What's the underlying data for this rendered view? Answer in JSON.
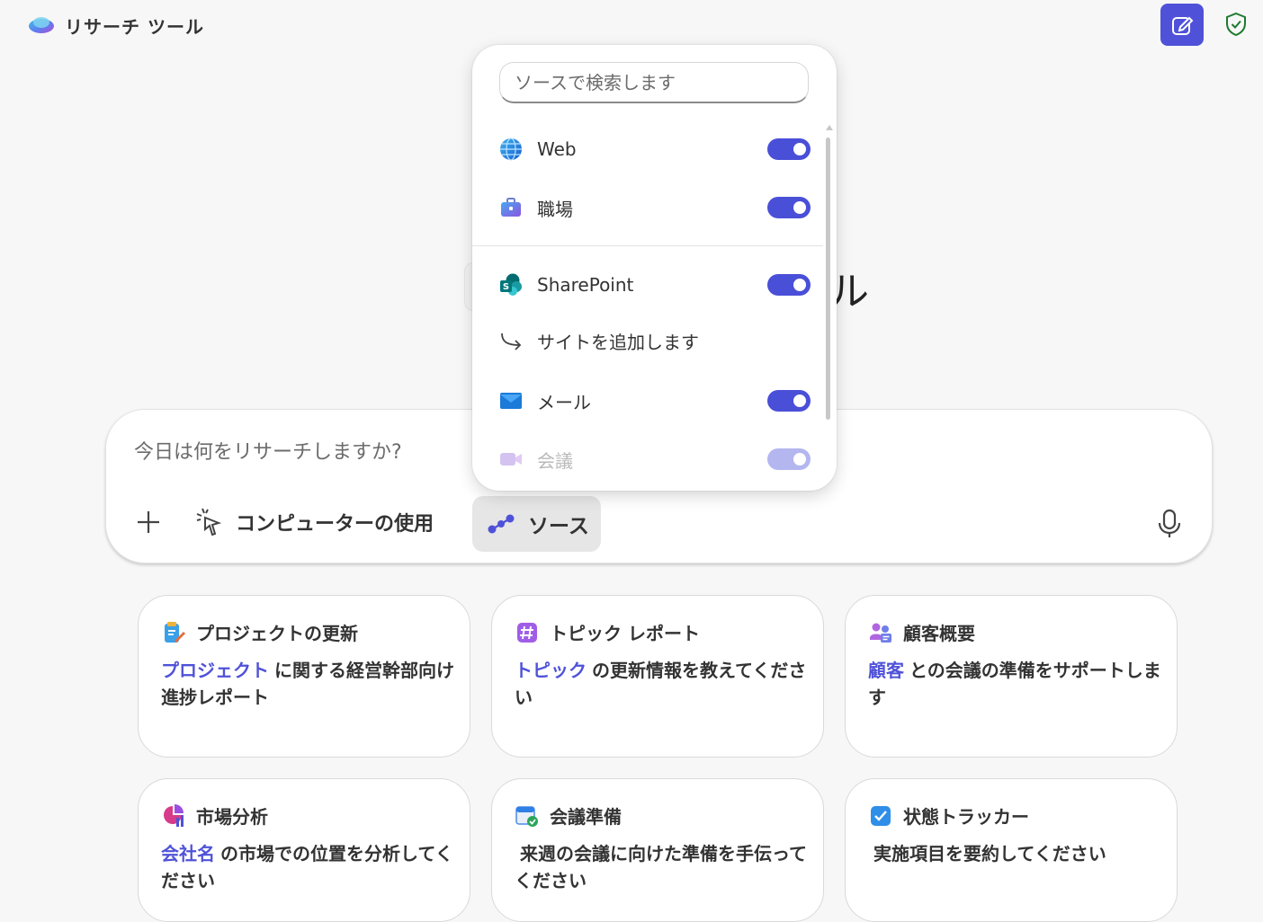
{
  "header": {
    "app_title": "リサーチ ツール",
    "compose_icon": "compose-icon",
    "shield_icon": "shield-check-icon"
  },
  "background_heading_glyph": "ル",
  "composer": {
    "placeholder": "今日は何をリサーチしますか?",
    "tools": {
      "add_icon": "plus-icon",
      "computer_use_label": "コンピューターの使用",
      "sources_label": "ソース"
    },
    "mic_icon": "microphone-icon"
  },
  "sources_popup": {
    "search_placeholder": "ソースで検索します",
    "items": [
      {
        "label": "Web",
        "icon": "globe-icon",
        "enabled": true
      },
      {
        "label": "職場",
        "icon": "briefcase-icon",
        "enabled": true
      },
      {
        "label": "SharePoint",
        "icon": "sharepoint-icon",
        "enabled": true
      },
      {
        "label": "サイトを追加します",
        "icon": "arrow-return-icon"
      },
      {
        "label": "メール",
        "icon": "mail-icon",
        "enabled": true
      },
      {
        "label": "会議",
        "icon": "meeting-icon",
        "enabled": true
      }
    ]
  },
  "cards": [
    {
      "title": "プロジェクトの更新",
      "keyword": "プロジェクト",
      "body": "に関する経営幹部向け進捗レポート",
      "icon": "clipboard-icon"
    },
    {
      "title": "トピック レポート",
      "keyword": "トピック",
      "body": "の更新情報を教えてください",
      "icon": "hash-icon"
    },
    {
      "title": "顧客概要",
      "keyword": "顧客",
      "body": "との会議の準備をサポートします",
      "icon": "people-icon"
    },
    {
      "title": "市場分析",
      "keyword": "会社名",
      "body": "の市場での位置を分析してください",
      "icon": "pie-chart-icon"
    },
    {
      "title": "会議準備",
      "keyword": "",
      "body": "来週の会議に向けた準備を手伝ってください",
      "icon": "calendar-check-icon"
    },
    {
      "title": "状態トラッカー",
      "keyword": "",
      "body": "実施項目を要約してください",
      "icon": "checkbox-icon"
    }
  ],
  "colors": {
    "accent": "#4f52d8",
    "background": "#f7f7f7",
    "toggle_on": "#4a4fd8"
  }
}
